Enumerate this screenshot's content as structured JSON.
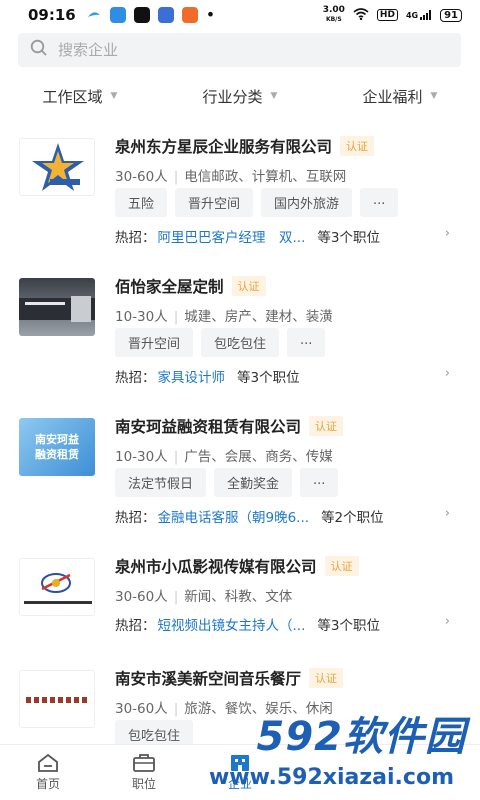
{
  "status_bar": {
    "time": "09:16",
    "netspeed_value": "3.00",
    "netspeed_unit": "KB/S",
    "hd": "HD",
    "signal": "4G",
    "battery": "91"
  },
  "search": {
    "placeholder": "搜索企业"
  },
  "filters": [
    {
      "label": "工作区域"
    },
    {
      "label": "行业分类"
    },
    {
      "label": "企业福利"
    }
  ],
  "companies": [
    {
      "name": "泉州东方星辰企业服务有限公司",
      "badge": "认证",
      "size": "30-60人",
      "industry": "电信邮政、计算机、互联网",
      "tags": [
        "五险",
        "晋升空间",
        "国内外旅游",
        "..."
      ],
      "hot_label": "热招：",
      "hot_position": "阿里巴巴客户经理　双...",
      "hot_more": "等3个职位"
    },
    {
      "name": "佰怡家全屋定制",
      "badge": "认证",
      "size": "10-30人",
      "industry": "城建、房产、建材、装潢",
      "tags": [
        "晋升空间",
        "包吃包住",
        "..."
      ],
      "hot_label": "热招：",
      "hot_position": "家具设计师",
      "hot_more": "等3个职位"
    },
    {
      "name": "南安珂益融资租赁有限公司",
      "badge": "认证",
      "size": "10-30人",
      "industry": "广告、会展、商务、传媒",
      "tags": [
        "法定节假日",
        "全勤奖金",
        "..."
      ],
      "hot_label": "热招：",
      "hot_position": "金融电话客服（朝9晚6...",
      "hot_more": "等2个职位"
    },
    {
      "name": "泉州市小瓜影视传媒有限公司",
      "badge": "认证",
      "size": "30-60人",
      "industry": "新闻、科教、文体",
      "tags": [],
      "hot_label": "热招：",
      "hot_position": "短视频出镜女主持人（...",
      "hot_more": "等3个职位"
    },
    {
      "name": "南安市溪美新空间音乐餐厅",
      "badge": "认证",
      "size": "30-60人",
      "industry": "旅游、餐饮、娱乐、休闲",
      "tags": [
        "包吃包住"
      ],
      "hot_label": "",
      "hot_position": "",
      "hot_more": ""
    }
  ],
  "logo_texts": {
    "c3": "南安珂益\n融资租赁"
  },
  "nav": [
    {
      "label": "首页",
      "icon": "home-icon"
    },
    {
      "label": "职位",
      "icon": "briefcase-icon"
    },
    {
      "label": "企业",
      "icon": "company-icon"
    }
  ],
  "watermark": {
    "big": "592软件园",
    "small": "www.592xiazai.com"
  },
  "colors": {
    "accent": "#1c78c9",
    "badge_text": "#e8a33c",
    "badge_bg": "#fdf3e3"
  }
}
